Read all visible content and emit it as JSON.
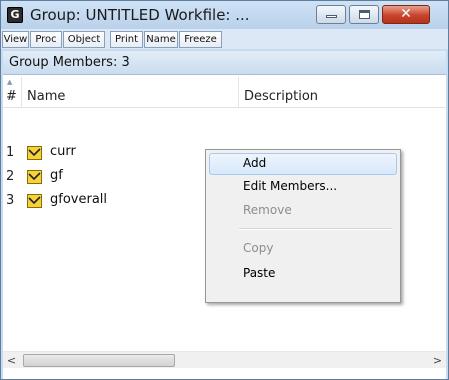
{
  "window": {
    "app_icon_letter": "G",
    "title": "Group: UNTITLED   Workfile: ..."
  },
  "toolbar": {
    "buttons": [
      "View",
      "Proc",
      "Object",
      "Print",
      "Name",
      "Freeze"
    ]
  },
  "group_header": "Group Members: 3",
  "table": {
    "columns": [
      "#",
      "Name",
      "Description"
    ],
    "rows": [
      {
        "num": "1",
        "name": "curr"
      },
      {
        "num": "2",
        "name": "gf"
      },
      {
        "num": "3",
        "name": "gfoverall"
      }
    ]
  },
  "context_menu": {
    "items": [
      {
        "label": "Add",
        "state": "highlighted"
      },
      {
        "label": "Edit Members...",
        "state": "enabled"
      },
      {
        "label": "Remove",
        "state": "disabled"
      },
      {
        "label": "Copy",
        "state": "disabled"
      },
      {
        "label": "Paste",
        "state": "enabled"
      }
    ]
  },
  "scrollbar": {
    "left_arrow": "<",
    "right_arrow": ">"
  },
  "icons": {
    "series": "series-icon",
    "window_min": "minimize-icon",
    "window_max": "maximize-icon",
    "window_close": "close-icon"
  },
  "colors": {
    "series_icon_yellow": "#f5d23c",
    "close_button_red": "#c8442b",
    "menu_highlight": "#d6e8fb"
  }
}
